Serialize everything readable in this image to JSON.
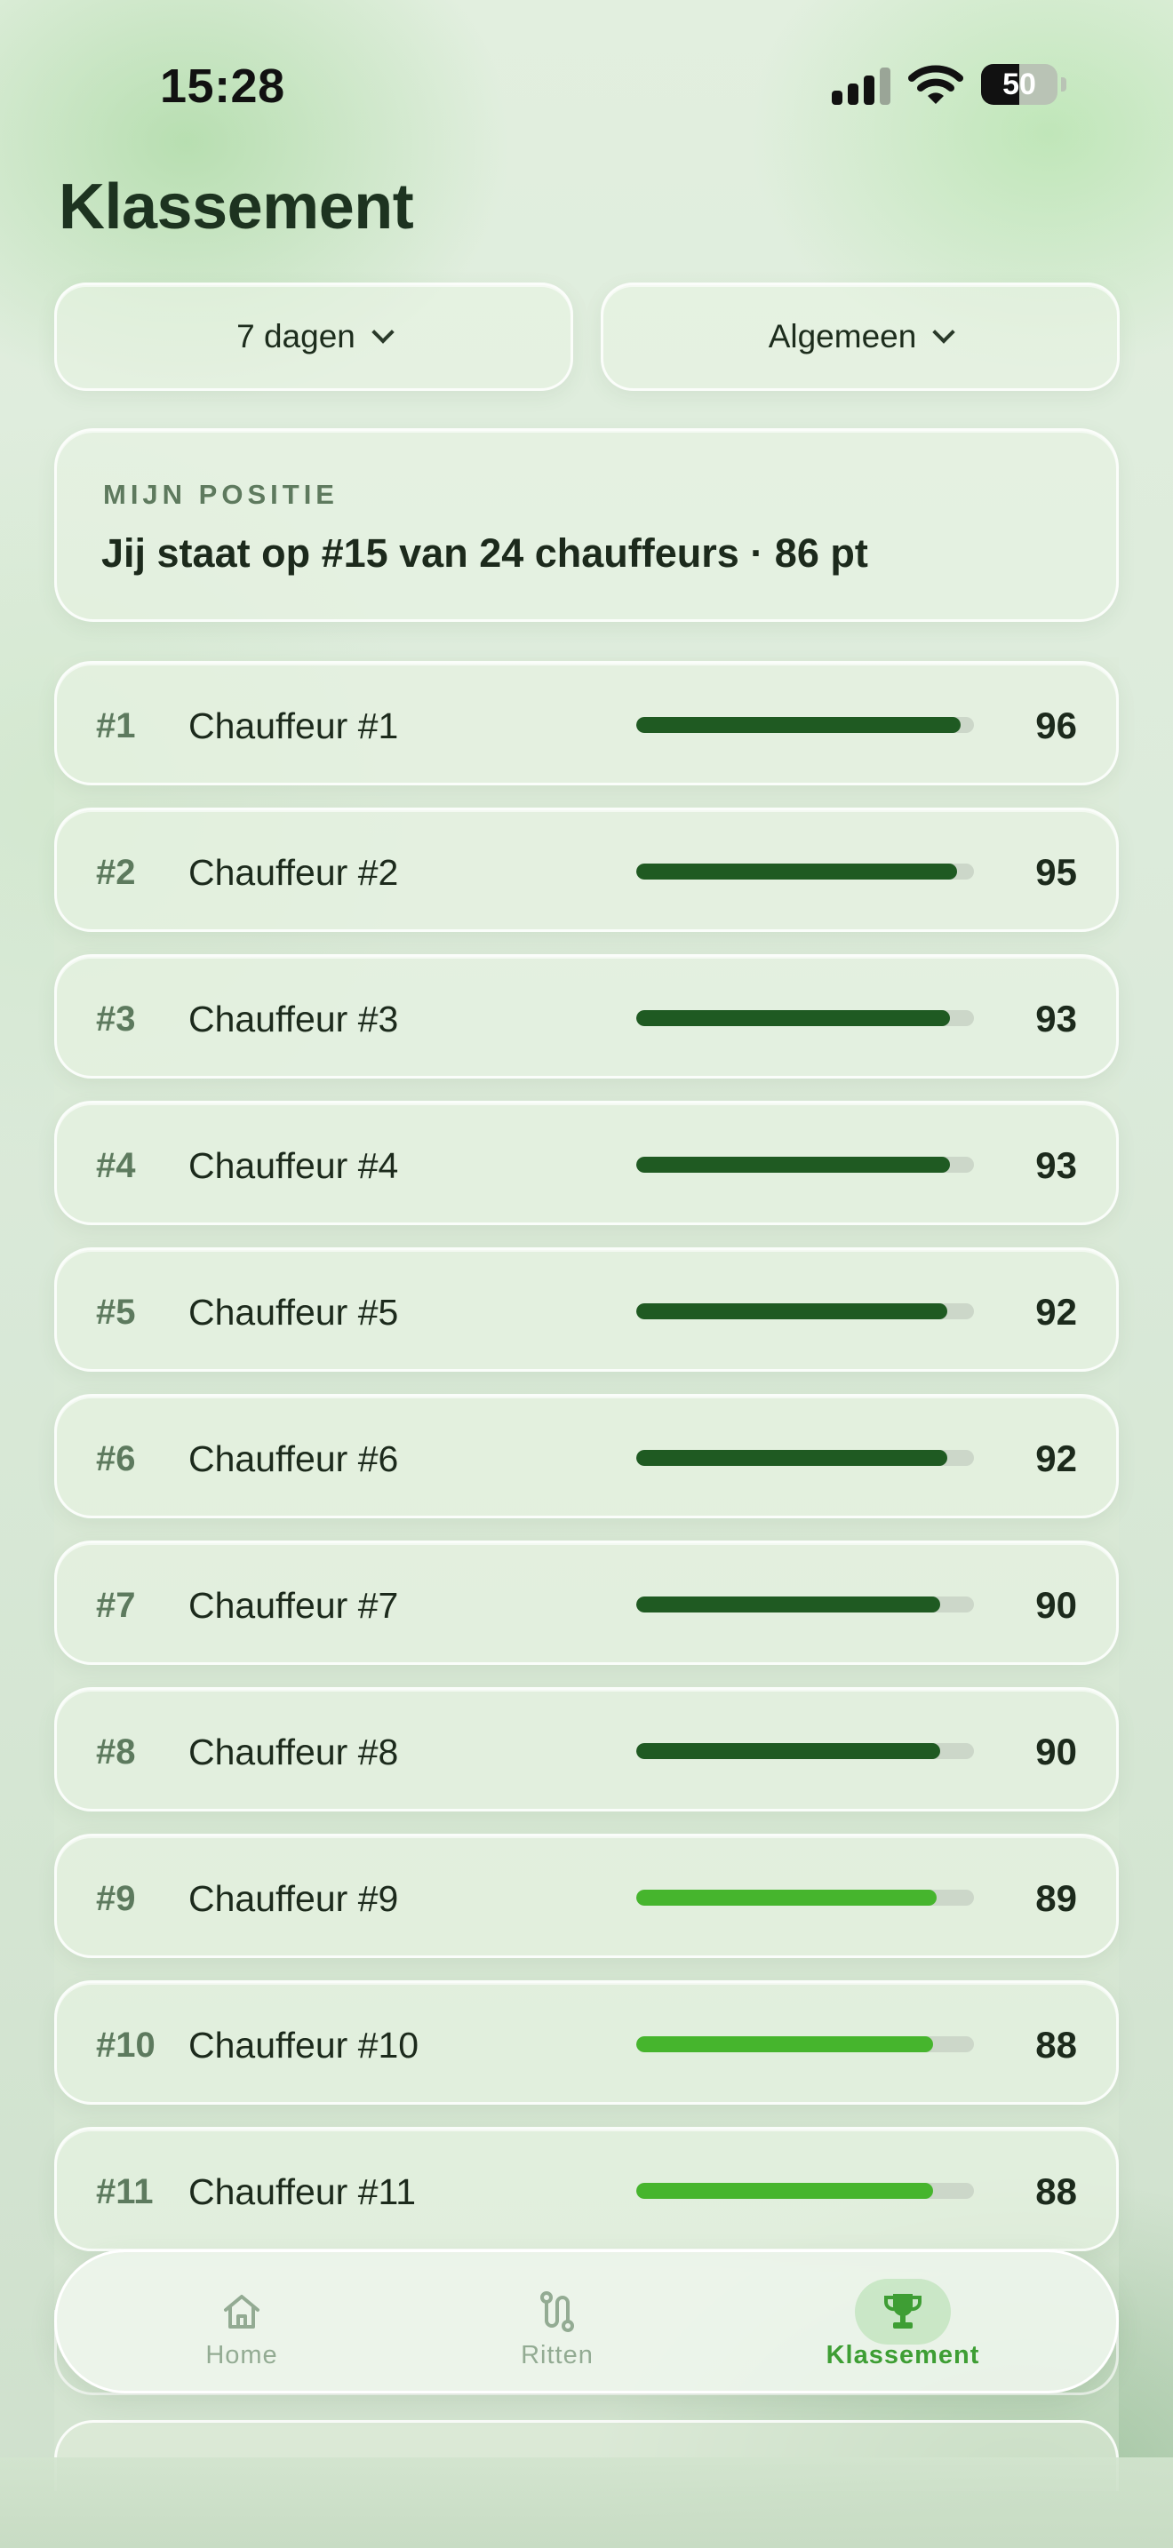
{
  "status_bar": {
    "time": "15:28",
    "battery_level": "50",
    "battery_fraction": 0.5
  },
  "page": {
    "title": "Klassement"
  },
  "filters": [
    {
      "label": "7 dagen"
    },
    {
      "label": "Algemeen"
    }
  ],
  "my_position": {
    "label": "MIJN POSITIE",
    "text": "Jij staat op #15 van 24 chauffeurs · 86 pt"
  },
  "colors": {
    "bar_dark": "#1f5a22",
    "bar_light": "#46b52d",
    "track": "#ccd7c9",
    "accent": "#3e9e34"
  },
  "leaderboard": [
    {
      "rank": "#1",
      "name": "Chauffeur #1",
      "score": "96",
      "value": 96,
      "tone": "dark"
    },
    {
      "rank": "#2",
      "name": "Chauffeur #2",
      "score": "95",
      "value": 95,
      "tone": "dark"
    },
    {
      "rank": "#3",
      "name": "Chauffeur #3",
      "score": "93",
      "value": 93,
      "tone": "dark"
    },
    {
      "rank": "#4",
      "name": "Chauffeur #4",
      "score": "93",
      "value": 93,
      "tone": "dark"
    },
    {
      "rank": "#5",
      "name": "Chauffeur #5",
      "score": "92",
      "value": 92,
      "tone": "dark"
    },
    {
      "rank": "#6",
      "name": "Chauffeur #6",
      "score": "92",
      "value": 92,
      "tone": "dark"
    },
    {
      "rank": "#7",
      "name": "Chauffeur #7",
      "score": "90",
      "value": 90,
      "tone": "dark"
    },
    {
      "rank": "#8",
      "name": "Chauffeur #8",
      "score": "90",
      "value": 90,
      "tone": "dark"
    },
    {
      "rank": "#9",
      "name": "Chauffeur #9",
      "score": "89",
      "value": 89,
      "tone": "light"
    },
    {
      "rank": "#10",
      "name": "Chauffeur #10",
      "score": "88",
      "value": 88,
      "tone": "light"
    },
    {
      "rank": "#11",
      "name": "Chauffeur #11",
      "score": "88",
      "value": 88,
      "tone": "light"
    }
  ],
  "tabbar": {
    "items": [
      {
        "label": "Home",
        "icon": "home-icon"
      },
      {
        "label": "Ritten",
        "icon": "route-icon"
      },
      {
        "label": "Klassement",
        "icon": "trophy-icon",
        "active": true
      }
    ]
  }
}
